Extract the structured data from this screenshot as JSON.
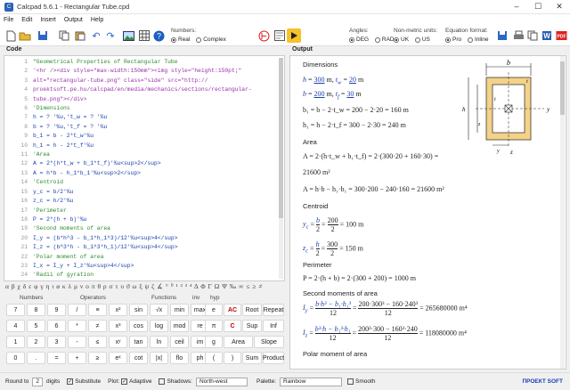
{
  "window": {
    "title": "Calcpad 5.6.1 - Rectangular Tube.cpd"
  },
  "menu": [
    "File",
    "Edit",
    "Insert",
    "Output",
    "Help"
  ],
  "numbers": {
    "label": "Numbers:",
    "options": [
      "Real",
      "Complex"
    ],
    "selected": "Real"
  },
  "angles": {
    "label": "Angles:",
    "options": [
      "DEG",
      "RAD"
    ],
    "selected": "DEG"
  },
  "units": {
    "label": "Non-metric units:",
    "options": [
      "UK",
      "US"
    ],
    "selected": "UK"
  },
  "equation": {
    "label": "Equation format:",
    "options": [
      "Pro",
      "Inline"
    ],
    "selected": "Pro"
  },
  "code": {
    "header": "Code",
    "lines": [
      "\"Geometrical Properties of Rectangular Tube",
      "'<hr /><div style=\"max-width:150mm\"><img style=\"height:150pt;\"",
      "alt=\"rectangular-tube.png\" class=\"side\" src=\"http://",
      "proektsoft.pe.hu/calcpad/en/media/mechanics/sections/rectangular-",
      "tube.png\"></div>",
      "'Dimensions",
      "h = ? '%u,'t_w = ? '%u",
      "b = ? '%u,'t_f = ? '%u",
      "b_1 = b - 2*t_w'%u",
      "h_1 = h - 2*t_f'%u",
      "'Area",
      "A = 2*(h*t_w + b_1*t_f)'%u<sup>2</sup>",
      "A = h*b - h_1*b_1'%u<sup>2</sup>",
      "'Centroid",
      "y_c = b/2'%u",
      "z_c = h/2'%u",
      "'Perimeter",
      "P = 2*(h + b)'%u",
      "'Second moments of area",
      "I_y = (b*h^3 - b_1*h_1^3)/12'%u<sup>4</sup>",
      "I_z = (b^3*h - b_1^3*h_1)/12'%u<sup>4</sup>",
      "'Polar moment of area",
      "I_x = I_y + I_z'%u<sup>4</sup>",
      "'Radii of gyration"
    ]
  },
  "greek": "α β χ δ ε φ γ η ι ø κ λ μ ν ο π θ ρ σ τ υ ϑ ω ξ ψ ζ ∡ ° ⁰ ¹ ² ³ ⁴ Δ Φ Γ Ω Ψ ‰ ∞ ≤ ≥ ≠",
  "keypad": {
    "headers": [
      "Numbers",
      "Operators",
      "Functions",
      "inv",
      "hyp"
    ],
    "rows": [
      [
        "7",
        "8",
        "9",
        "/",
        "≡",
        "x²",
        "sin",
        "√x",
        "min",
        "max",
        "e",
        "AC",
        "Root",
        "Repeat"
      ],
      [
        "4",
        "5",
        "6",
        "*",
        "≠",
        "x³",
        "cos",
        "log",
        "mod",
        "re",
        "π",
        "C",
        "Sup",
        "Inf"
      ],
      [
        "1",
        "2",
        "3",
        "-",
        "≤",
        "xʸ",
        "tan",
        "ln",
        "ceil",
        "im",
        "g",
        "Area",
        "Slope"
      ],
      [
        "0",
        ".",
        "=",
        "+",
        "≥",
        "eˣ",
        "cot",
        "|x|",
        "flo",
        "ph",
        "(",
        ")",
        "Sum",
        "Product"
      ]
    ]
  },
  "output": {
    "header": "Output",
    "sections": [
      "Dimensions",
      "Area",
      "Centroid",
      "Perimeter",
      "Second moments of area",
      "Polar moment of area"
    ],
    "inputs": {
      "h": "300",
      "t_w": "20",
      "b": "200",
      "t_f": "30",
      "unit": "m"
    },
    "b1": "b₁ = b − 2·t_w = 200 − 2·20 = 160 m",
    "h1": "h₁ = h − 2·t_f = 300 − 2·30 = 240 m",
    "A1": "A = 2·(h·t_w + b₁·t_f) = 2·(300·20 + 160·30) =",
    "A1r": "21600 m²",
    "A2": "A = h·b − h₁·b₁ = 300·200 − 240·160 = 21600 m²",
    "yc": "= 100 m",
    "zc": "= 150 m",
    "P": "P = 2·(h + b) = 2·(300 + 200) = 1000 m",
    "Iy": "= 265680000 m⁴",
    "Iz": "= 118080000 m⁴"
  },
  "status": {
    "round_label": "Round to",
    "round_value": "2",
    "digits": "digits",
    "substitute": "Substitute",
    "plot": "Plot:",
    "adaptive": "Adaptive",
    "shadows": "Shadows:",
    "shadows_value": "North-west",
    "palette": "Palette:",
    "palette_value": "Rainbow",
    "smooth": "Smooth",
    "logo": "ПРОЕКТ SOFT"
  }
}
